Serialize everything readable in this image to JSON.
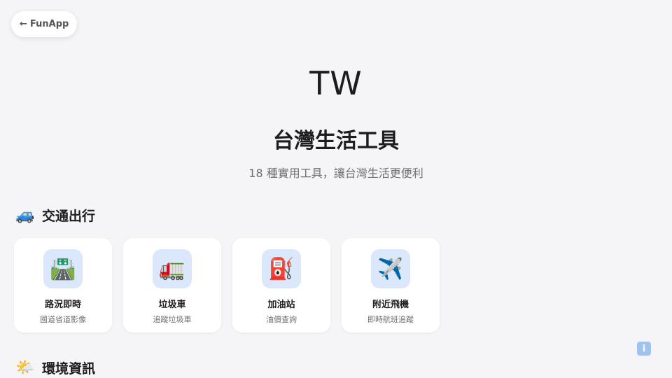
{
  "nav": {
    "back_arrow": "←",
    "back_label": "FunApp"
  },
  "hero": {
    "flag_text": "TW",
    "title": "台灣生活工具",
    "subtitle": "18 種實用工具，讓台灣生活更便利"
  },
  "sections": [
    {
      "icon": "🚙",
      "icon_name": "car-icon",
      "title": "交通出行",
      "cards": [
        {
          "icon": "🛣️",
          "icon_name": "highway-icon",
          "title": "路況即時",
          "desc": "國道省道影像"
        },
        {
          "icon": "🚛",
          "icon_name": "garbage-truck-icon",
          "title": "垃圾車",
          "desc": "追蹤垃圾車"
        },
        {
          "icon": "⛽",
          "icon_name": "fuel-pump-icon",
          "title": "加油站",
          "desc": "油價查詢"
        },
        {
          "icon": "✈️",
          "icon_name": "airplane-icon",
          "title": "附近飛機",
          "desc": "即時航班追蹤"
        }
      ]
    },
    {
      "icon": "🌤️",
      "icon_name": "sun-cloud-icon",
      "title": "環境資訊"
    }
  ],
  "info_button": {
    "glyph": "i",
    "icon_name": "info-icon"
  },
  "colors": {
    "background": "#f5f5f7",
    "card": "#ffffff",
    "icon_tile": "#dbe8fb",
    "info_button": "#9ec3f0",
    "subtitle_text": "#6e6e73"
  }
}
